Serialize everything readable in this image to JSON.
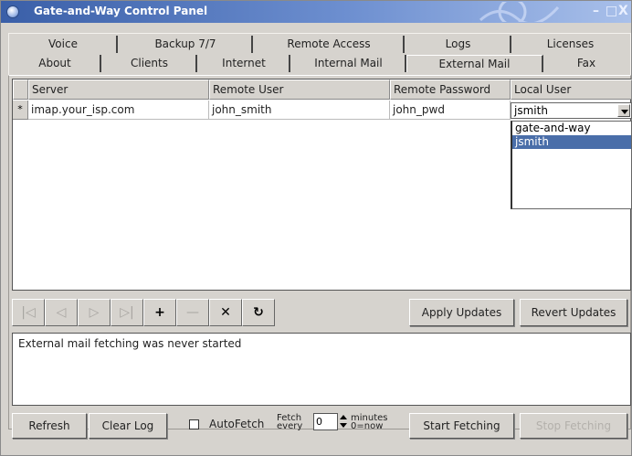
{
  "window": {
    "title": "Gate-and-Way Control Panel",
    "minimize": "–",
    "maximize": "□",
    "close": "X"
  },
  "tabs": {
    "row1": [
      "Voice",
      "Backup 7/7",
      "Remote Access",
      "Logs",
      "Licenses"
    ],
    "row2": [
      "About",
      "Clients",
      "Internet",
      "Internal Mail",
      "External Mail",
      "Fax"
    ],
    "active": "External Mail"
  },
  "grid": {
    "columns": [
      "Server",
      "Remote User",
      "Remote Password",
      "Local User"
    ],
    "rows": [
      {
        "marker": "*",
        "server": "imap.your_isp.com",
        "remote_user": "john_smith",
        "remote_password": "john_pwd",
        "local_user": "jsmith"
      }
    ],
    "dropdown_options": [
      "gate-and-way",
      "jsmith"
    ],
    "dropdown_selected": "jsmith"
  },
  "nav": {
    "first": "|◁",
    "prev": "◁",
    "next": "▷",
    "last": "▷|",
    "add": "+",
    "remove": "—",
    "delete": "✕",
    "refresh": "↻"
  },
  "buttons": {
    "apply": "Apply Updates",
    "revert": "Revert Updates",
    "refresh": "Refresh",
    "clear_log": "Clear Log",
    "start": "Start Fetching",
    "stop": "Stop Fetching"
  },
  "log": {
    "text": "External mail fetching was never started"
  },
  "autofetch": {
    "label": "AutoFetch",
    "fetch_line1": "Fetch",
    "fetch_line2": "every",
    "value": "0",
    "unit_line1": "minutes",
    "unit_line2": "0=now",
    "checked": false
  }
}
